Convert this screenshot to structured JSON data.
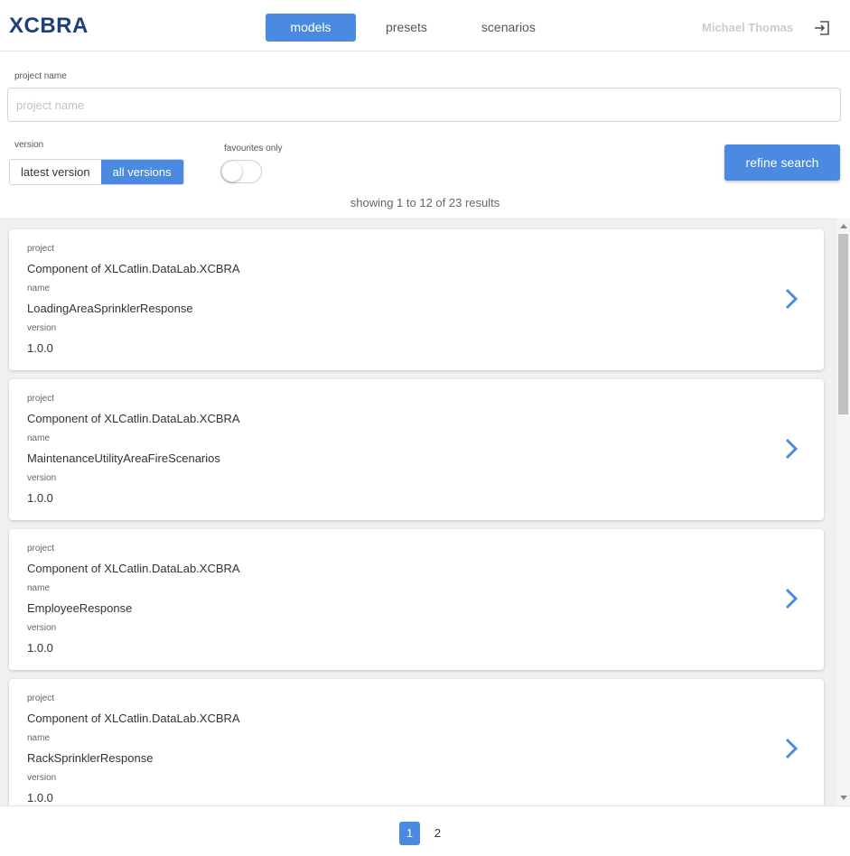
{
  "app": {
    "logo": "XCBRA"
  },
  "nav": {
    "tabs": [
      {
        "label": "models"
      },
      {
        "label": "presets"
      },
      {
        "label": "scenarios"
      }
    ]
  },
  "user": {
    "name": "Michael Thomas"
  },
  "filters": {
    "project_label": "project name",
    "project_placeholder": "project name",
    "project_value": "",
    "version_label": "version",
    "version_options": [
      {
        "label": "latest version"
      },
      {
        "label": "all versions"
      }
    ],
    "version_selected": "all versions",
    "favourites_label": "favourites only",
    "favourites_on": false,
    "refine_label": "refine search"
  },
  "results": {
    "summary": "showing 1 to 12 of 23 results"
  },
  "field_labels": {
    "project": "project",
    "name": "name",
    "version": "version"
  },
  "cards": [
    {
      "project": "Component of XLCatlin.DataLab.XCBRA",
      "name": "LoadingAreaSprinklerResponse",
      "version": "1.0.0"
    },
    {
      "project": "Component of XLCatlin.DataLab.XCBRA",
      "name": "MaintenanceUtilityAreaFireScenarios",
      "version": "1.0.0"
    },
    {
      "project": "Component of XLCatlin.DataLab.XCBRA",
      "name": "EmployeeResponse",
      "version": "1.0.0"
    },
    {
      "project": "Component of XLCatlin.DataLab.XCBRA",
      "name": "RackSprinklerResponse",
      "version": "1.0.0"
    }
  ],
  "pagination": {
    "pages": [
      {
        "label": "1"
      },
      {
        "label": "2"
      }
    ],
    "current": "1"
  },
  "colors": {
    "accent": "#4a8ae0",
    "logo": "#1f3f7a",
    "background": "#f0f0f0"
  },
  "icons": {
    "logout": "logout-icon",
    "chevron": "chevron-right-icon"
  }
}
